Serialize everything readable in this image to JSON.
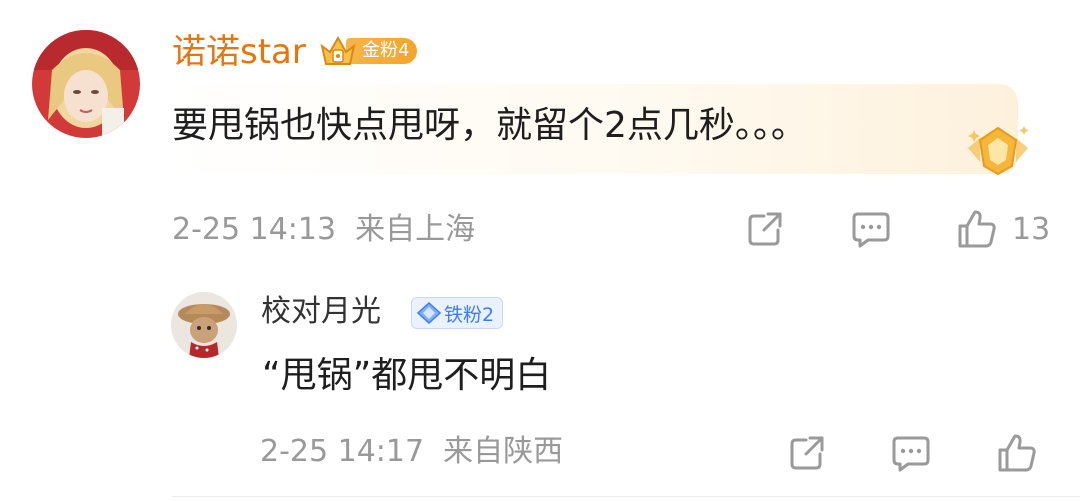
{
  "comment": {
    "username": "诺诺star",
    "badge_label": "金粉4",
    "text": "要甩锅也快点甩呀，就留个2点几秒。。。",
    "time": "2-25 14:13",
    "location": "来自上海",
    "like_count": "13"
  },
  "reply": {
    "username": "校对月光",
    "badge_label": "铁粉2",
    "text": "“甩锅”都甩不明白",
    "time": "2-25 14:17",
    "location": "来自陕西"
  },
  "colors": {
    "gold_name": "#e8740c",
    "meta_gray": "#999999",
    "iron_badge_blue": "#3d7dff"
  },
  "icons": [
    "share-icon",
    "comment-icon",
    "like-icon",
    "crown-icon",
    "diamond-icon",
    "medal-icon"
  ]
}
